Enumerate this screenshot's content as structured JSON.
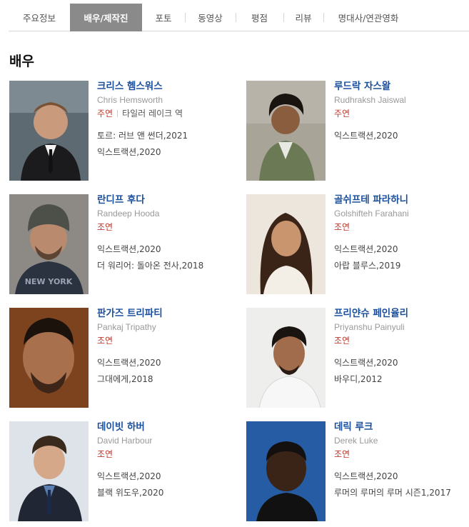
{
  "tabs": [
    {
      "label": "주요정보",
      "active": false
    },
    {
      "label": "배우/제작진",
      "active": true
    },
    {
      "label": "포토",
      "active": false
    },
    {
      "label": "동영상",
      "active": false
    },
    {
      "label": "평점",
      "active": false
    },
    {
      "label": "리뷰",
      "active": false
    },
    {
      "label": "명대사/연관영화",
      "active": false
    }
  ],
  "section_title": "배우",
  "actors": [
    {
      "name": "크리스 헴스워스",
      "english_name": "Chris Hemsworth",
      "role": "주연",
      "character": "타일러 레이크 역",
      "films": [
        "토르: 러브 앤 썬더,2021",
        "익스트랙션,2020"
      ]
    },
    {
      "name": "루드락 자스왈",
      "english_name": "Rudhraksh Jaiswal",
      "role": "주연",
      "character": "",
      "films": [
        "익스트랙션,2020"
      ]
    },
    {
      "name": "란디프 후다",
      "english_name": "Randeep Hooda",
      "role": "조연",
      "character": "",
      "films": [
        "익스트랙션,2020",
        "더 워리어: 돌아온 전사,2018"
      ]
    },
    {
      "name": "골쉬프테 파라하니",
      "english_name": "Golshifteh Farahani",
      "role": "조연",
      "character": "",
      "films": [
        "익스트랙션,2020",
        "아랍 블루스,2019"
      ]
    },
    {
      "name": "판가즈 트리파티",
      "english_name": "Pankaj Tripathy",
      "role": "조연",
      "character": "",
      "films": [
        "익스트랙션,2020",
        "그대에게,2018"
      ]
    },
    {
      "name": "프리얀슈 페인율리",
      "english_name": "Priyanshu Painyuli",
      "role": "조연",
      "character": "",
      "films": [
        "익스트랙션,2020",
        "바우디,2012"
      ]
    },
    {
      "name": "데이빗 하버",
      "english_name": "David Harbour",
      "role": "조연",
      "character": "",
      "films": [
        "익스트랙션,2020",
        "블랙 위도우,2020"
      ]
    },
    {
      "name": "데릭 루크",
      "english_name": "Derek Luke",
      "role": "조연",
      "character": "",
      "films": [
        "익스트랙션,2020",
        "루머의 루머의 루머 시즌1,2017"
      ]
    }
  ],
  "colors": {
    "active_tab_bg": "#8a8a8a",
    "name_link": "#1a4f9c",
    "role": "#c0392b"
  }
}
